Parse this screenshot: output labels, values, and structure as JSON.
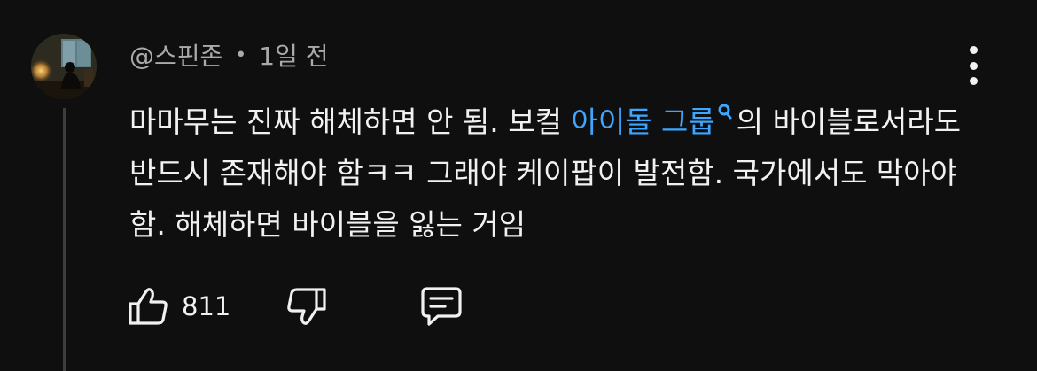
{
  "comment": {
    "author": "@스핀존",
    "separator": "•",
    "time": "1일 전",
    "text_before": "마마무는 진짜 해체하면 안 됨. 보컬 ",
    "link_text": "아이돌 그룹",
    "text_after": "의 바이블로서라도 반드시 존재해야 함ㅋㅋ 그래야 케이팝이 발전함. 국가에서도 막아야 함. 해체하면 바이블을 잃는 거임",
    "like_count": "811"
  },
  "icons": {
    "avatar": "avatar-image",
    "more": "more-vertical-icon",
    "search_mark": "search-icon",
    "like": "thumbs-up-icon",
    "dislike": "thumbs-down-icon",
    "reply": "reply-comment-icon"
  },
  "colors": {
    "background": "#0f0f0f",
    "text": "#f1f1f1",
    "secondary_text": "#aaaaaa",
    "link": "#3ea6ff",
    "thread_line": "#3d3d3d"
  }
}
